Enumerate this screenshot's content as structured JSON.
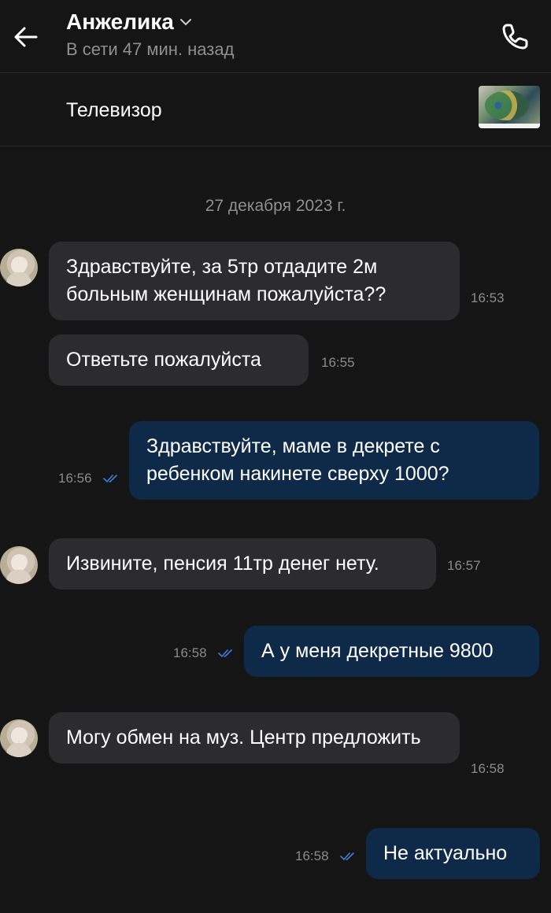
{
  "header": {
    "contact_name": "Анжелика",
    "status": "В сети 47 мин. назад"
  },
  "listing": {
    "title": "Телевизор"
  },
  "chat": {
    "date": "27 декабря 2023 г.",
    "messages": [
      {
        "from": "contact",
        "text": "Здравствуйте, за 5тр отдадите 2м больным женщинам пожалуйста??",
        "time": "16:53"
      },
      {
        "from": "contact",
        "text": "Ответьте пожалуйста",
        "time": "16:55"
      },
      {
        "from": "me",
        "text": "Здравствуйте, маме в декрете с ребенком накинете сверху 1000?",
        "time": "16:56",
        "read": true
      },
      {
        "from": "contact",
        "text": "Извините, пенсия 11тр денег нету.",
        "time": "16:57"
      },
      {
        "from": "me",
        "text": "А у меня декретные 9800",
        "time": "16:58",
        "read": true
      },
      {
        "from": "contact",
        "text": "Могу обмен на муз. Центр предложить",
        "time": "16:58"
      },
      {
        "from": "me",
        "text": "Не актуально",
        "time": "16:58",
        "read": true
      }
    ]
  },
  "icons": {
    "back": "arrow-left-icon",
    "phone": "phone-icon",
    "chevron": "chevron-down-icon",
    "read_receipt": "double-check-icon"
  },
  "colors": {
    "background": "#151515",
    "incoming_bubble": "#2c2c2e",
    "outgoing_bubble": "#0f2a49",
    "read_tick": "#3d7fd6"
  }
}
